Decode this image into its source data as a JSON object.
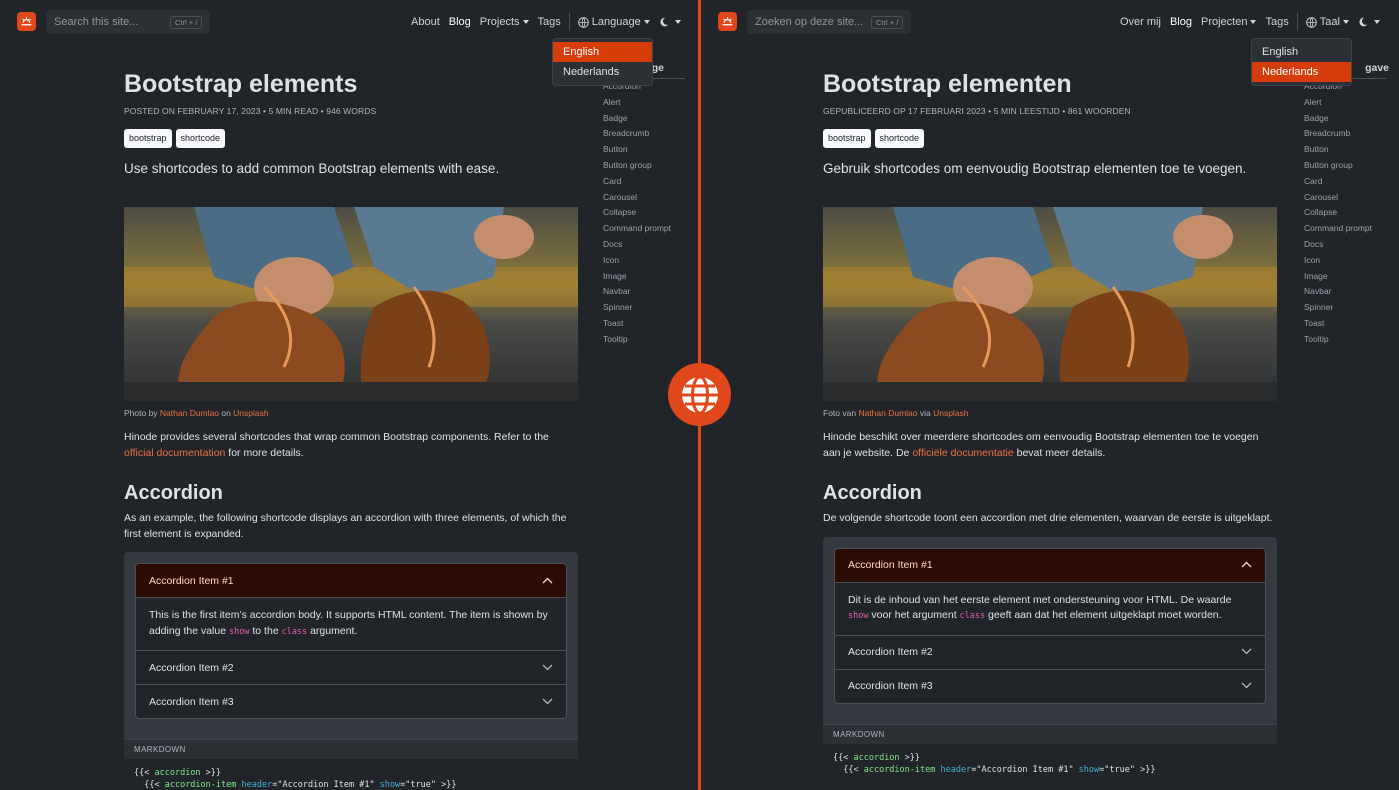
{
  "left": {
    "search": {
      "placeholder": "Search this site...",
      "shortcut": "Ctrl + /"
    },
    "nav": {
      "about": "About",
      "blog": "Blog",
      "projects": "Projects",
      "tags": "Tags",
      "language": "Language"
    },
    "dropdown": {
      "options": [
        "English",
        "Nederlands"
      ],
      "selected": "English"
    },
    "article": {
      "title": "Bootstrap elements",
      "meta": "POSTED ON FEBRUARY 17, 2023 • 5 MIN READ • 946 WORDS",
      "tags": [
        "bootstrap",
        "shortcode"
      ],
      "lead": "Use shortcodes to add common Bootstrap elements with ease.",
      "caption": {
        "prefix": "Photo by ",
        "author": "Nathan Dumlao",
        "mid": " on ",
        "site": "Unsplash"
      },
      "intro": {
        "text1": "Hinode provides several shortcodes that wrap common Bootstrap components. Refer to the ",
        "link": "official documentation",
        "text2": " for more details."
      },
      "accordion_heading": "Accordion",
      "accordion_intro": "As an example, the following shortcode displays an accordion with three elements, of which the first element is expanded.",
      "accordion": {
        "item1": "Accordion Item #1",
        "body": {
          "t1": "This is the first item’s accordion body. It supports HTML content. The item is shown by adding the value ",
          "c1": "show",
          "t2": " to the ",
          "c2": "class",
          "t3": " argument."
        },
        "item2": "Accordion Item #2",
        "item3": "Accordion Item #3"
      },
      "md_label": "MARKDOWN",
      "code": {
        "l1a": "{{< ",
        "l1b": "accordion",
        "l1c": " >}}",
        "l2a": "  {{< ",
        "l2b": "accordion-item",
        "l2c": " header",
        "l2d": "=",
        "l2e": "\"Accordion Item #1\"",
        "l2f": " show",
        "l2g": "=",
        "l2h": "\"true\"",
        "l2i": " >}}"
      }
    },
    "toc": {
      "title": "On this page",
      "title_visible": "ge"
    }
  },
  "right": {
    "search": {
      "placeholder": "Zoeken op deze site...",
      "shortcut": "Ctrl + /"
    },
    "nav": {
      "about": "Over mij",
      "blog": "Blog",
      "projects": "Projecten",
      "tags": "Tags",
      "language": "Taal"
    },
    "dropdown": {
      "options": [
        "English",
        "Nederlands"
      ],
      "selected": "Nederlands"
    },
    "article": {
      "title": "Bootstrap elementen",
      "meta": "GEPUBLICEERD OP 17 FEBRUARI 2023 • 5 MIN LEESTIJD • 861 WOORDEN",
      "tags": [
        "bootstrap",
        "shortcode"
      ],
      "lead": "Gebruik shortcodes om eenvoudig Bootstrap elementen toe te voegen.",
      "caption": {
        "prefix": "Foto van ",
        "author": "Nathan Dumlao",
        "mid": " via ",
        "site": "Unsplash"
      },
      "intro": {
        "text1": "Hinode beschikt over meerdere shortcodes om eenvoudig Bootstrap elementen toe te voegen aan je website. De ",
        "link": "officiële documentatie",
        "text2": " bevat meer details."
      },
      "accordion_heading": "Accordion",
      "accordion_intro": "De volgende shortcode toont een accordion met drie elementen, waarvan de eerste is uitgeklapt.",
      "accordion": {
        "item1": "Accordion Item #1",
        "body": {
          "t1": "Dit is de inhoud van het eerste element met ondersteuning voor HTML. De waarde ",
          "c1": "show",
          "t2": " voor het argument ",
          "c2": "class",
          "t3": " geeft aan dat het element uitgeklapt moet worden."
        },
        "item2": "Accordion Item #2",
        "item3": "Accordion Item #3"
      },
      "md_label": "MARKDOWN",
      "code": {
        "l1a": "{{< ",
        "l1b": "accordion",
        "l1c": " >}}",
        "l2a": "  {{< ",
        "l2b": "accordion-item",
        "l2c": " header",
        "l2d": "=",
        "l2e": "\"Accordion Item #1\"",
        "l2f": " show",
        "l2g": "=",
        "l2h": "\"true\"",
        "l2i": " >}}"
      }
    },
    "toc": {
      "title": "Inhoudsopgave",
      "title_visible": "gave"
    }
  },
  "toc_items": [
    "Accordion",
    "Alert",
    "Badge",
    "Breadcrumb",
    "Button",
    "Button group",
    "Card",
    "Carousel",
    "Collapse",
    "Command prompt",
    "Docs",
    "Icon",
    "Image",
    "Navbar",
    "Spinner",
    "Toast",
    "Tooltip"
  ],
  "colors": {
    "accent": "#e0481b",
    "background": "#212529",
    "link": "#e8733f",
    "accordion_open": "#2c0b02"
  }
}
